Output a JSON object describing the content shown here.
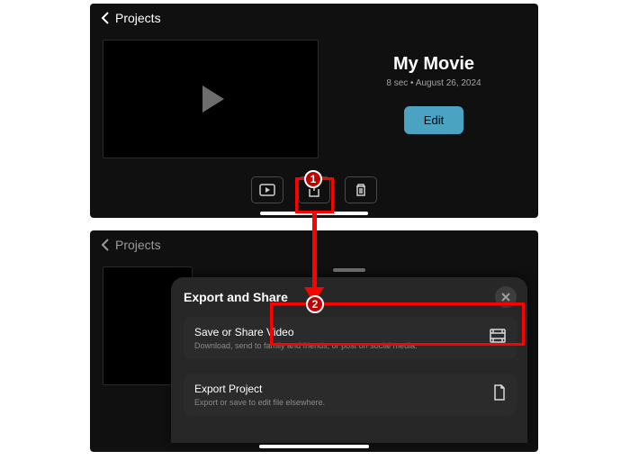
{
  "top": {
    "back_label": "Projects",
    "movie_title": "My Movie",
    "movie_subtitle": "8 sec • August 26, 2024",
    "edit_button": "Edit"
  },
  "bottom": {
    "back_label": "Projects"
  },
  "sheet": {
    "title": "Export and Share",
    "rows": [
      {
        "label": "Save or Share Video",
        "desc": "Download, send to family and friends, or post on social media."
      },
      {
        "label": "Export Project",
        "desc": "Export or save to edit file elsewhere."
      }
    ]
  },
  "annotations": {
    "step1": "1",
    "step2": "2"
  }
}
